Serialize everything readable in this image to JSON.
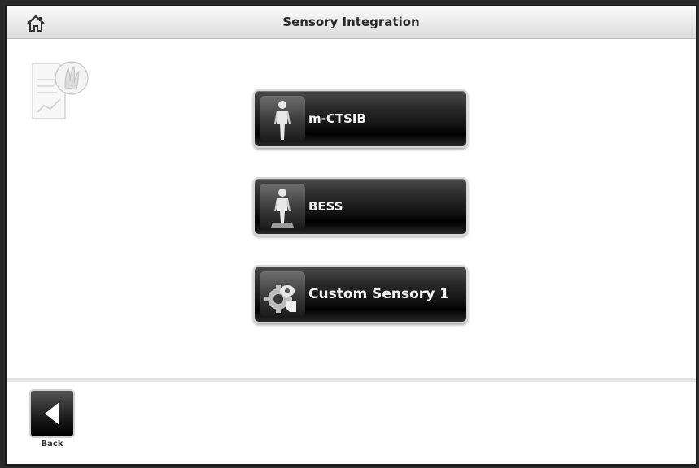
{
  "header": {
    "title": "Sensory Integration",
    "home_icon": "home-icon"
  },
  "tests": [
    {
      "label": "m-CTSIB",
      "icon": "standing-person-icon"
    },
    {
      "label": "BESS",
      "icon": "standing-person-on-foam-icon"
    },
    {
      "label": "Custom Sensory 1",
      "icon": "custom-sensory-gear-icon"
    }
  ],
  "footer": {
    "back_label": "Back",
    "back_icon": "back-arrow-icon"
  },
  "colors": {
    "button_dark": "#141414",
    "button_text": "#f4f4f4",
    "title_text": "#2a2a2a"
  }
}
